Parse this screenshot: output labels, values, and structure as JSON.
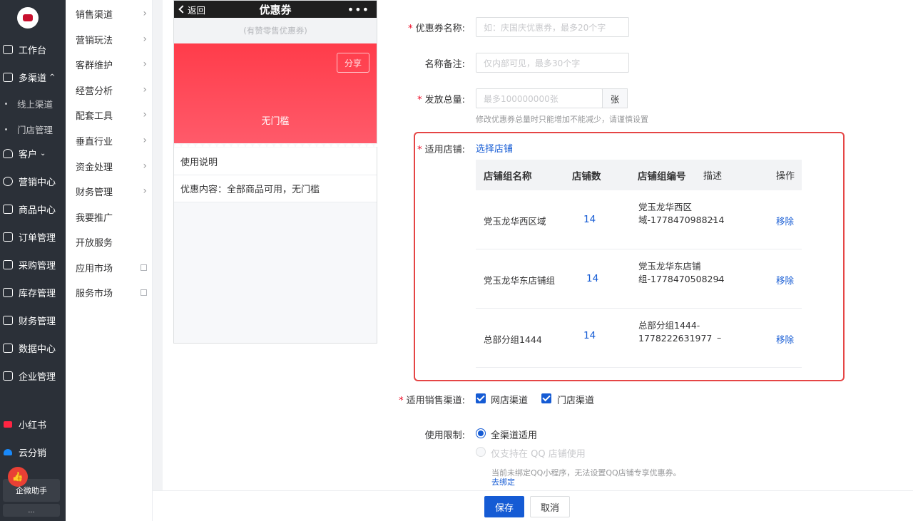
{
  "rail": {
    "items": [
      {
        "label": "工作台",
        "icon": "chat-icon"
      },
      {
        "label": "多渠道",
        "icon": "store-icon",
        "caret": "^"
      },
      {
        "label": "线上渠道"
      },
      {
        "label": "门店管理"
      },
      {
        "label": "客户",
        "icon": "user-icon",
        "caret": "⌄"
      },
      {
        "label": "营销中心",
        "icon": "target-icon"
      },
      {
        "label": "商品中心",
        "icon": "bag-icon"
      },
      {
        "label": "订单管理",
        "icon": "order-icon"
      },
      {
        "label": "采购管理",
        "icon": "cart-icon"
      },
      {
        "label": "库存管理",
        "icon": "warehouse-icon"
      },
      {
        "label": "财务管理",
        "icon": "finance-icon"
      },
      {
        "label": "数据中心",
        "icon": "bar-chart-icon"
      },
      {
        "label": "企业管理",
        "icon": "building-icon"
      },
      {
        "label": "小红书",
        "icon": "xiaohongshu-icon",
        "color": "#ff2442"
      },
      {
        "label": "云分销",
        "icon": "cloud-icon",
        "color": "#1989fa"
      }
    ],
    "assistant_label": "企微助手",
    "more_label": "..."
  },
  "submenu": {
    "items": [
      {
        "label": "销售渠道",
        "arrow": "›"
      },
      {
        "label": "营销玩法",
        "arrow": "›"
      },
      {
        "label": "客群维护",
        "arrow": "›"
      },
      {
        "label": "经营分析",
        "arrow": "›"
      },
      {
        "label": "配套工具",
        "arrow": "›"
      },
      {
        "label": "垂直行业",
        "arrow": "›"
      },
      {
        "label": "资金处理",
        "arrow": "›"
      },
      {
        "label": "财务管理",
        "arrow": "›"
      },
      {
        "label": "我要推广"
      },
      {
        "label": "开放服务"
      },
      {
        "label": "应用市场",
        "external": true
      },
      {
        "label": "服务市场",
        "external": true
      }
    ]
  },
  "preview": {
    "back_label": "返回",
    "title": "优惠券",
    "menu_label": "•••",
    "subtitle": "(有赞零售优惠券)",
    "share_label": "分享",
    "coupon_condition": "无门槛",
    "usage_title": "使用说明",
    "usage_content": "优惠内容：全部商品可用，无门槛"
  },
  "form": {
    "name_label": "优惠券名称:",
    "name_placeholder": "如：庆国庆优惠券，最多20个字",
    "remark_label": "名称备注:",
    "remark_placeholder": "仅内部可见，最多30个字",
    "total_label": "发放总量:",
    "total_placeholder": "最多100000000张",
    "total_unit": "张",
    "total_hint": "修改优惠券总量时只能增加不能减少，请谨慎设置",
    "stores_label": "适用店铺:",
    "stores_link": "选择店铺",
    "channel_label": "适用销售渠道:",
    "channels": [
      "网店渠道",
      "门店渠道"
    ],
    "limit_label": "使用限制:",
    "limit_options": [
      "全渠道适用",
      "仅支持在 QQ 店铺使用"
    ],
    "qq_hint": "当前未绑定QQ小程序，无法设置QQ店铺专享优惠券。",
    "qq_link": "去绑定"
  },
  "table": {
    "headers": [
      "店铺组名称",
      "店铺数",
      "店铺组编号",
      "描述",
      "操作"
    ],
    "rows": [
      {
        "name": "党玉龙华西区域",
        "count": "14",
        "code": "党玉龙华西区域-1778470988214",
        "desc": "–",
        "action": "移除"
      },
      {
        "name": "党玉龙华东店铺组",
        "count": "14",
        "code": "党玉龙华东店铺组-1778470508294",
        "desc": "–",
        "action": "移除"
      },
      {
        "name": "总部分组1444",
        "count": "14",
        "code": "总部分组1444-1778222631977",
        "desc": "–",
        "action": "移除"
      }
    ]
  },
  "footer": {
    "save_label": "保存",
    "cancel_label": "取消"
  },
  "colors": {
    "accent": "#155bd4",
    "danger": "#ee0a24",
    "coupon": "#ff4050",
    "highlight": "#e54545",
    "rail": "#2b3038"
  }
}
